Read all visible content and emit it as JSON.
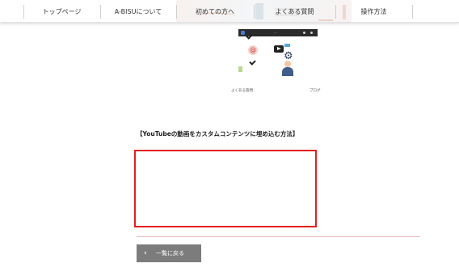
{
  "nav": {
    "items": [
      {
        "label": "トップページ"
      },
      {
        "label": "A-BISUについて"
      },
      {
        "label": "初めての方へ"
      },
      {
        "label": "よくある質問"
      },
      {
        "label": "操作方法"
      }
    ]
  },
  "thumbnail": {
    "caption_left": "よくある質問",
    "caption_right": "ブログ",
    "video_title": "…",
    "at_symbol": "@",
    "icons": [
      "play-icon",
      "gear-icon",
      "person-icon"
    ]
  },
  "article": {
    "heading": "【YouTubeの動画をカスタムコンテンツに埋め込む方法】"
  },
  "back_button": {
    "label": "一覧に戻る",
    "chevron": "‹"
  },
  "colors": {
    "highlight_border": "#e2201d",
    "button_bg": "#7c7c7c",
    "divider": "#e8b7b3"
  }
}
